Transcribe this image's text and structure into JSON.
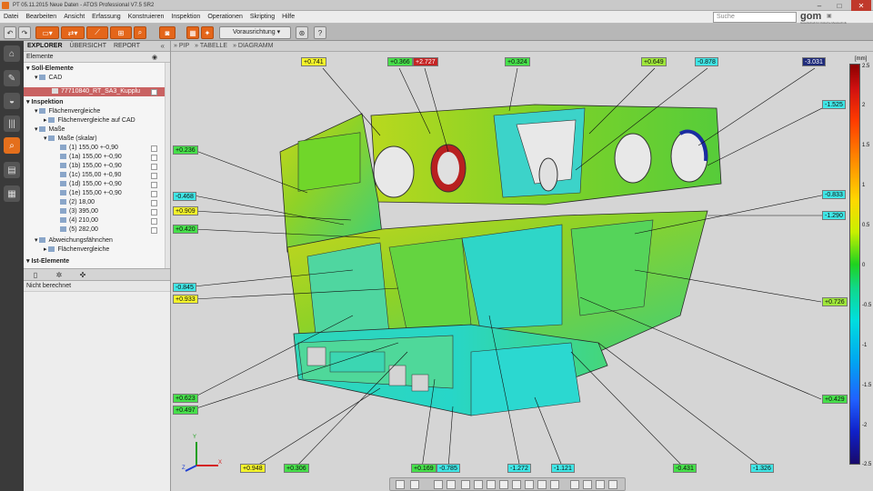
{
  "window": {
    "title": "PT 05.11.2015 Neue Daten - ATOS Professional V7.5 SR2",
    "controls": [
      "–",
      "□",
      "✕"
    ]
  },
  "menu": [
    "Datei",
    "Bearbeiten",
    "Ansicht",
    "Erfassung",
    "Konstruieren",
    "Inspektion",
    "Operationen",
    "Skripting",
    "Hilfe"
  ],
  "search": {
    "placeholder": "Suche"
  },
  "logo": {
    "text": "gom",
    "subtitle": "Gesellschaft für Optische Messtechnik"
  },
  "toolbar": {
    "undo_icon": "undo-icon",
    "redo_icon": "redo-icon",
    "alignment_label": "Vorausrichtung",
    "help_label": "?"
  },
  "left_bar": {
    "icons": [
      "home-icon",
      "wrench-icon",
      "car-icon",
      "barcode-icon",
      "search-icon",
      "calculator-icon",
      "grid-icon"
    ]
  },
  "panel": {
    "tabs": [
      "EXPLORER",
      "ÜBERSICHT",
      "REPORT"
    ],
    "header": "Elemente",
    "tree": [
      {
        "label": "Soll-Elemente",
        "level": 0,
        "bold": true
      },
      {
        "label": "CAD",
        "level": 1,
        "bold": false
      },
      {
        "label": "77710840_RT_SA3_Kupplu",
        "level": 2,
        "bold": false,
        "selected": true
      },
      {
        "label": "Inspektion",
        "level": 0,
        "bold": true
      },
      {
        "label": "Flächenvergleiche",
        "level": 1,
        "bold": false
      },
      {
        "label": "Flächenvergleiche auf CAD",
        "level": 2,
        "bold": false
      },
      {
        "label": "Maße",
        "level": 1,
        "bold": false
      },
      {
        "label": "Maße (skalar)",
        "level": 2,
        "bold": false
      },
      {
        "label": "(1) 155,00 +-0,90",
        "level": 3,
        "bold": false
      },
      {
        "label": "(1a) 155,00 +-0,90",
        "level": 3,
        "bold": false
      },
      {
        "label": "(1b) 155,00 +-0,90",
        "level": 3,
        "bold": false
      },
      {
        "label": "(1c) 155,00 +-0,90",
        "level": 3,
        "bold": false
      },
      {
        "label": "(1d) 155,00 +-0,90",
        "level": 3,
        "bold": false
      },
      {
        "label": "(1e) 155,00 +-0,90",
        "level": 3,
        "bold": false
      },
      {
        "label": "(2) 18,00",
        "level": 3,
        "bold": false
      },
      {
        "label": "(3) 395,00",
        "level": 3,
        "bold": false
      },
      {
        "label": "(4) 210,00",
        "level": 3,
        "bold": false
      },
      {
        "label": "(5) 282,00",
        "level": 3,
        "bold": false
      },
      {
        "label": "Abweichungsfähnchen",
        "level": 1,
        "bold": false
      },
      {
        "label": "Flächenvergleiche",
        "level": 2,
        "bold": false
      },
      {
        "label": "Ist-Elemente",
        "level": 0,
        "bold": true
      }
    ],
    "props_status": "Nicht berechnet"
  },
  "viewport_tabs": [
    "PIP",
    "TABELLE",
    "DIAGRAMM"
  ],
  "colorbar": {
    "unit": "[mm]",
    "ticks": [
      "2.5",
      "2",
      "1.5",
      "1",
      "0.5",
      "0",
      "-0.5",
      "-1",
      "-1.5",
      "-2",
      "-2.5"
    ]
  },
  "deviation_labels": [
    {
      "text": "+0.741",
      "color": "y"
    },
    {
      "text": "+0.366",
      "color": "g"
    },
    {
      "text": "+2.727",
      "color": "r"
    },
    {
      "text": "+0.324",
      "color": "g"
    },
    {
      "text": "+0.649",
      "color": "lg"
    },
    {
      "text": "-0.878",
      "color": "c"
    },
    {
      "text": "-3.031",
      "color": "n"
    },
    {
      "text": "-1.525",
      "color": "c"
    },
    {
      "text": "+0.236",
      "color": "g"
    },
    {
      "text": "-0.468",
      "color": "c"
    },
    {
      "text": "+0.909",
      "color": "y"
    },
    {
      "text": "+0.420",
      "color": "g"
    },
    {
      "text": "-0.833",
      "color": "c"
    },
    {
      "text": "-1.290",
      "color": "c"
    },
    {
      "text": "-0.845",
      "color": "c"
    },
    {
      "text": "+0.933",
      "color": "y"
    },
    {
      "text": "+0.726",
      "color": "lg"
    },
    {
      "text": "+0.623",
      "color": "g"
    },
    {
      "text": "+0.497",
      "color": "g"
    },
    {
      "text": "+0.429",
      "color": "g"
    },
    {
      "text": "+0.948",
      "color": "y"
    },
    {
      "text": "+0.306",
      "color": "g"
    },
    {
      "text": "+0.169",
      "color": "g"
    },
    {
      "text": "-0.785",
      "color": "c"
    },
    {
      "text": "-1.272",
      "color": "c"
    },
    {
      "text": "-1.121",
      "color": "c"
    },
    {
      "text": "-0.431",
      "color": "g"
    },
    {
      "text": "-1.326",
      "color": "c"
    }
  ],
  "axes": {
    "x": "X",
    "y": "Y",
    "z": "Z"
  }
}
